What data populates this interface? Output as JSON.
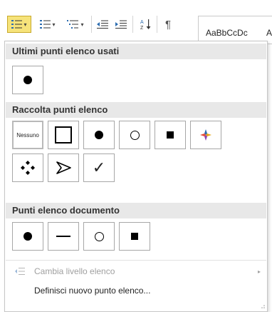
{
  "ribbon": {
    "gallery_preview": "AaBbCcDc",
    "gallery_preview_next": "A",
    "pilcrow": "¶",
    "caret": "▾"
  },
  "dropdown": {
    "recent_header": "Ultimi punti elenco usati",
    "library_header": "Raccolta punti elenco",
    "document_header": "Punti elenco documento",
    "none_label": "Nessuno",
    "check_glyph": "✓",
    "change_level_label": "Cambia livello elenco",
    "define_new_label": "Definisci nuovo punto elenco...",
    "submenu_arrow": "▸"
  },
  "colors": {
    "highlight": "#f6e37a",
    "header_bg": "#e8e8e8",
    "disabled_text": "#a0a0a0"
  }
}
